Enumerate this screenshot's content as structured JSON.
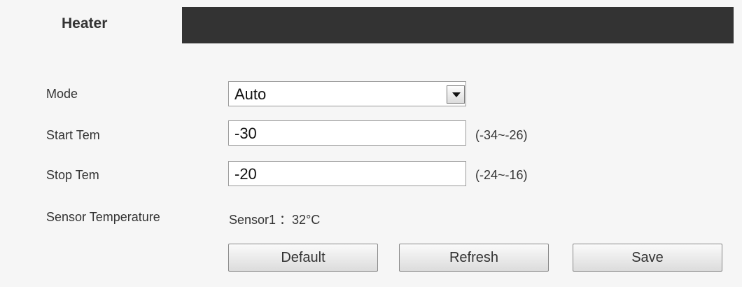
{
  "tabs": [
    {
      "label": "Heater"
    }
  ],
  "form": {
    "mode": {
      "label": "Mode",
      "value": "Auto"
    },
    "start_temp": {
      "label": "Start Tem",
      "value": "-30",
      "range": "(-34~-26)"
    },
    "stop_temp": {
      "label": "Stop Tem",
      "value": "-20",
      "range": "(-24~-16)"
    },
    "sensor": {
      "label": "Sensor Temperature",
      "value": "Sensor1 ：32°C"
    }
  },
  "buttons": {
    "default": "Default",
    "refresh": "Refresh",
    "save": "Save"
  },
  "icons": {
    "dropdown": "chevron-down-icon"
  },
  "colors": {
    "tabbar": "#333333",
    "page_bg": "#f6f6f6",
    "field_border": "#9a9a9a"
  }
}
